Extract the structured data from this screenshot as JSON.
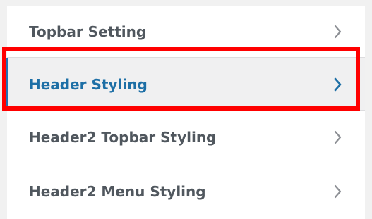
{
  "menu": {
    "items": [
      {
        "label": "Topbar Setting",
        "active": false
      },
      {
        "label": "Header Styling",
        "active": true
      },
      {
        "label": "Header2 Topbar Styling",
        "active": false
      },
      {
        "label": "Header2 Menu Styling",
        "active": false
      }
    ],
    "chevron_icon": "chevron-right-icon"
  },
  "colors": {
    "label_default": "#50575e",
    "label_active": "#1d6fa6",
    "active_background": "#f0f0f1",
    "highlight_outline": "#ff0000",
    "chevron_default": "#8c8f94"
  }
}
